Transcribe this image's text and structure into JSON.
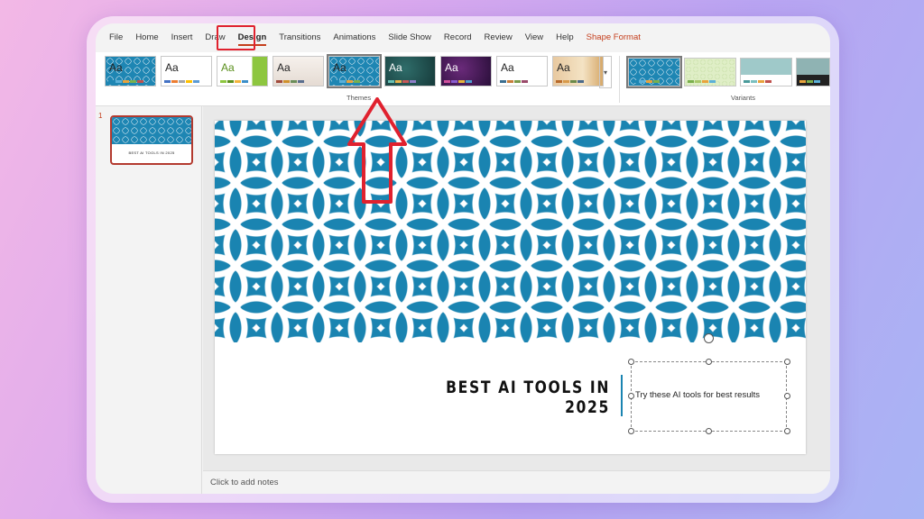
{
  "menu": {
    "items": [
      {
        "label": "File",
        "name": "menu-file"
      },
      {
        "label": "Home",
        "name": "menu-home"
      },
      {
        "label": "Insert",
        "name": "menu-insert"
      },
      {
        "label": "Draw",
        "name": "menu-draw"
      },
      {
        "label": "Design",
        "name": "menu-design"
      },
      {
        "label": "Transitions",
        "name": "menu-transitions"
      },
      {
        "label": "Animations",
        "name": "menu-animations"
      },
      {
        "label": "Slide Show",
        "name": "menu-slide-show"
      },
      {
        "label": "Record",
        "name": "menu-record"
      },
      {
        "label": "Review",
        "name": "menu-review"
      },
      {
        "label": "View",
        "name": "menu-view"
      },
      {
        "label": "Help",
        "name": "menu-help"
      },
      {
        "label": "Shape Format",
        "name": "menu-shape-format"
      }
    ],
    "active": "Design",
    "contextual_tab": "Shape Format"
  },
  "ribbon": {
    "themes_label": "Themes",
    "variants_label": "Variants",
    "theme_sample_text": "Aa",
    "more_icon": "gallery-more-icon"
  },
  "thumbnails": {
    "slide_number": "1",
    "thumb_title": "BEST AI TOOLS IN 2025"
  },
  "slide": {
    "title": "BEST AI TOOLS IN 2025",
    "subtitle": "Try these AI tools for best results"
  },
  "notes": {
    "placeholder": "Click to add notes"
  },
  "colors": {
    "accent": "#c43e1c",
    "pattern_blue": "#1a84b1",
    "highlight_red": "#e0212e"
  }
}
